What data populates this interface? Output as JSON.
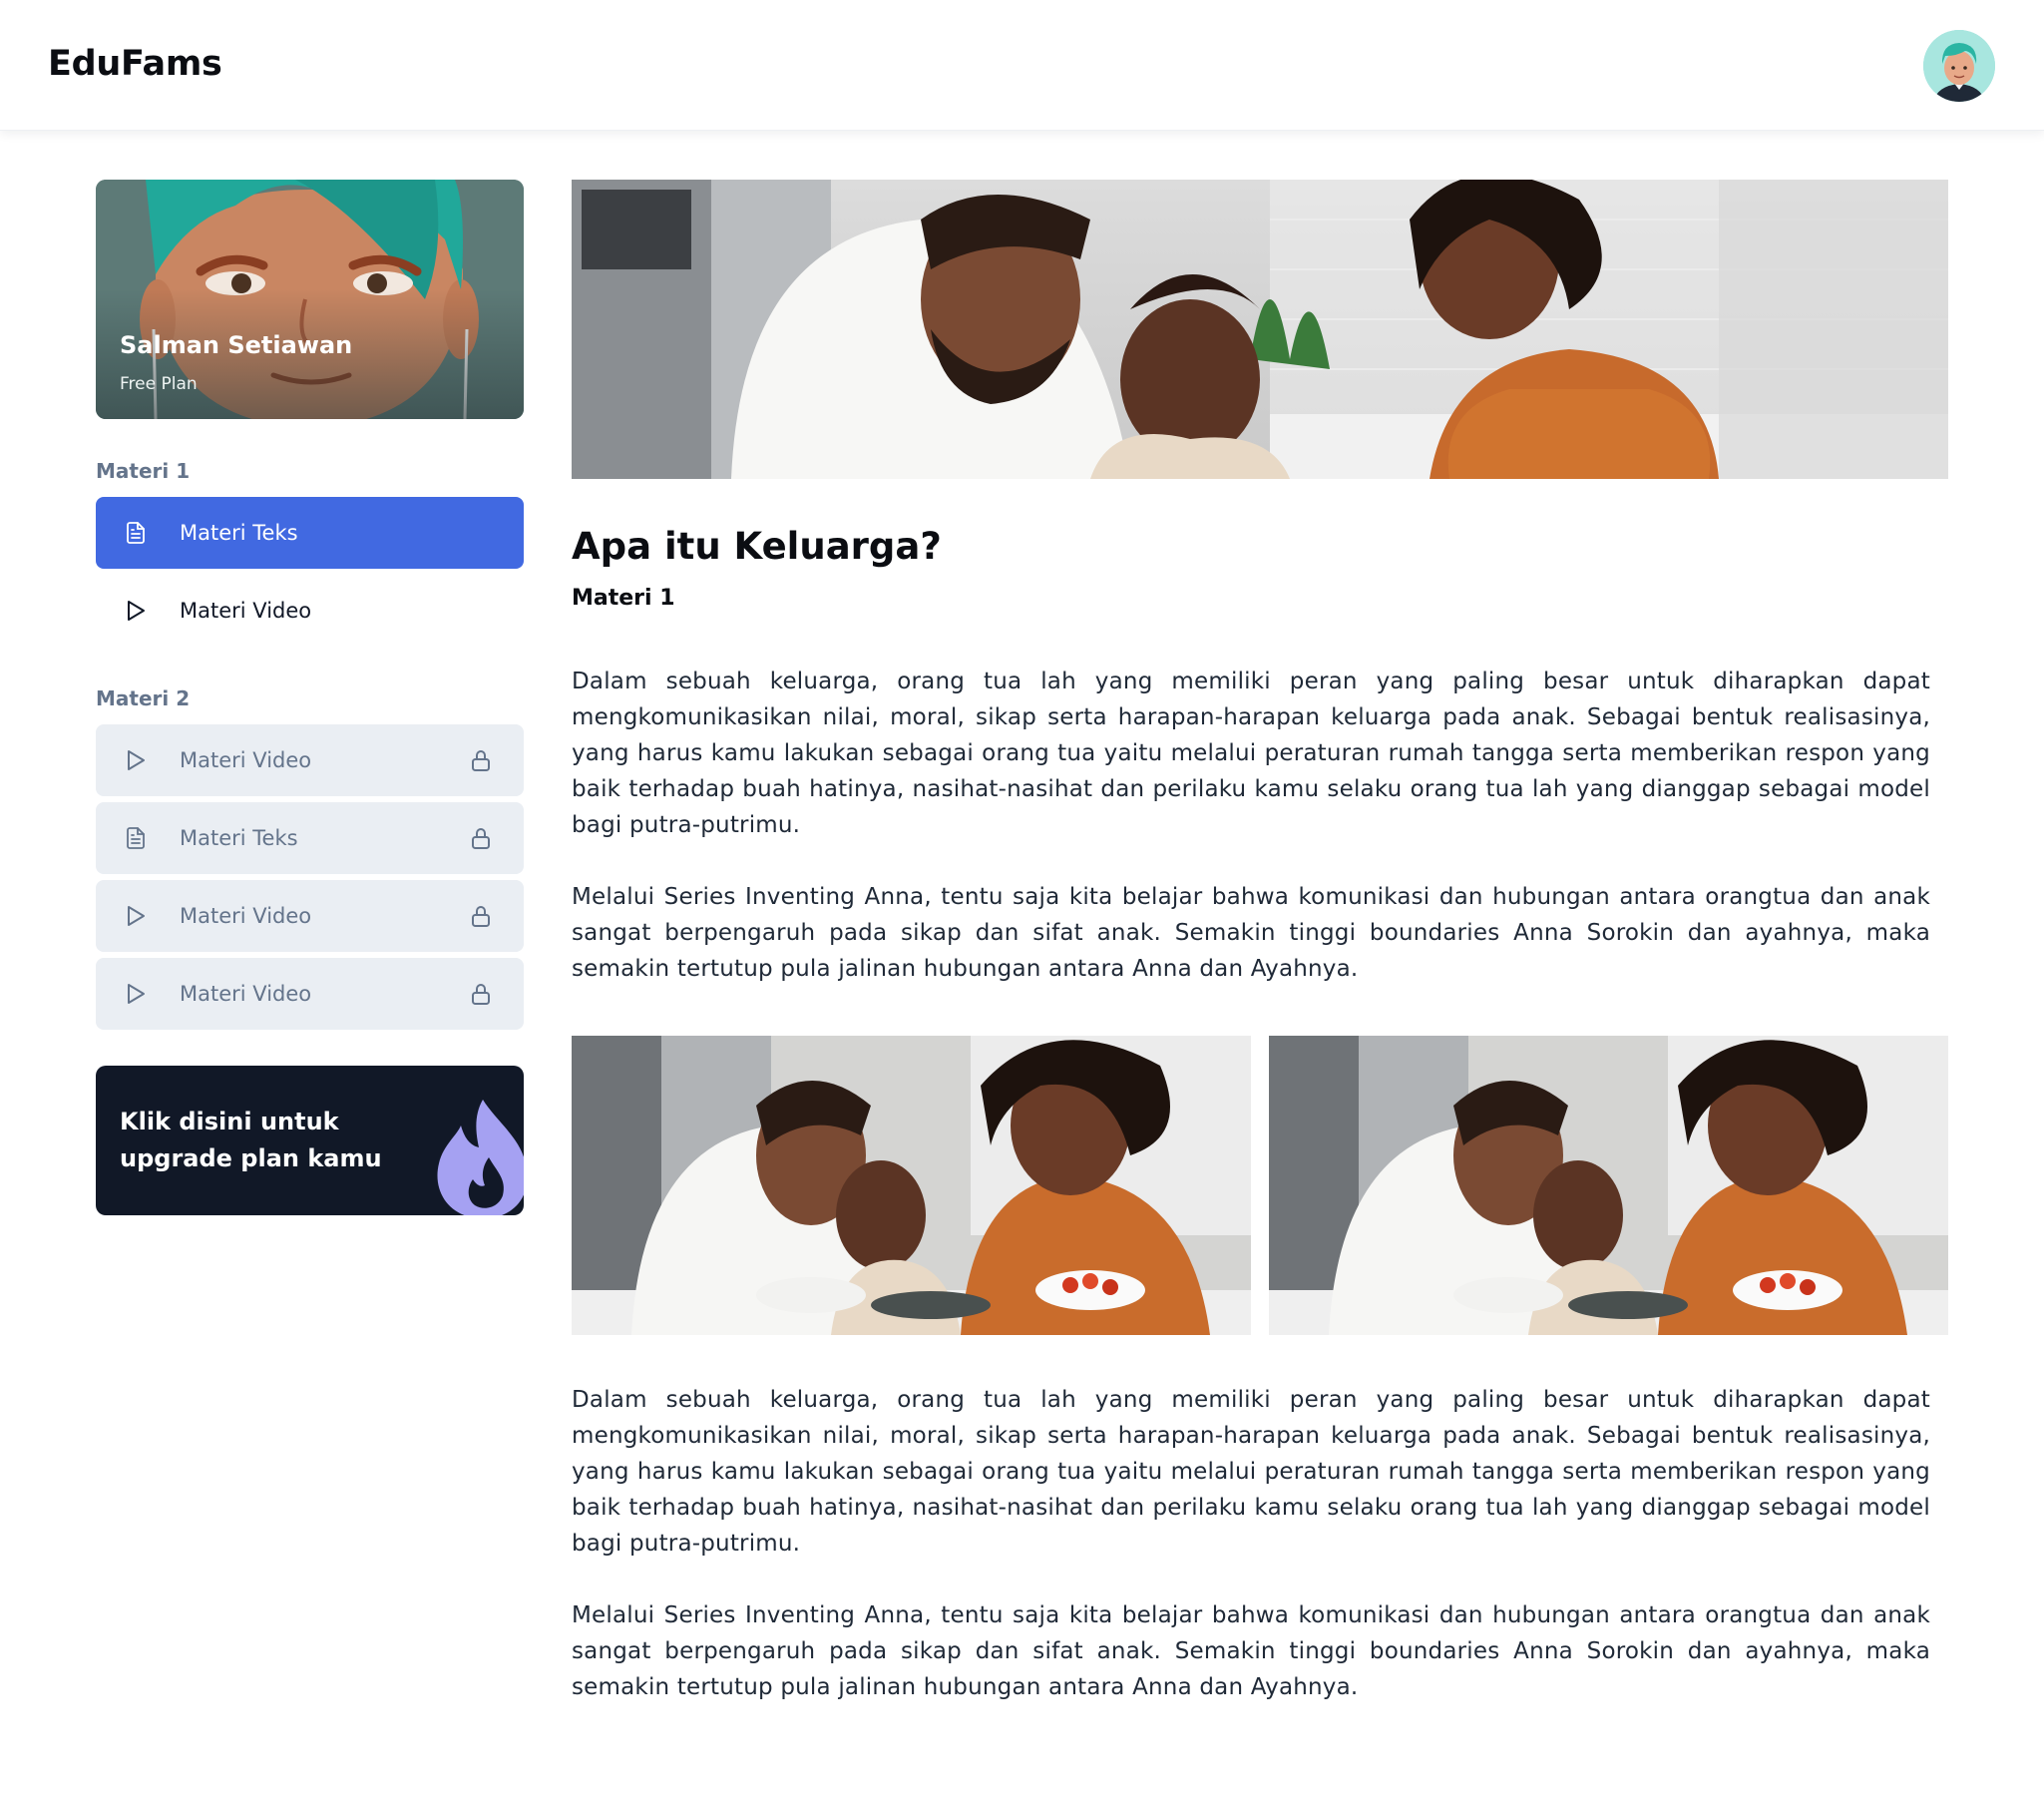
{
  "app": {
    "brand": "EduFams"
  },
  "profile": {
    "name": "Salman Setiawan",
    "plan": "Free Plan"
  },
  "sidebar": {
    "sections": [
      {
        "label": "Materi 1",
        "items": [
          {
            "label": "Materi Teks",
            "icon": "document-icon",
            "state": "active"
          },
          {
            "label": "Materi Video",
            "icon": "play-icon",
            "state": "unlocked"
          }
        ]
      },
      {
        "label": "Materi 2",
        "items": [
          {
            "label": "Materi Video",
            "icon": "play-icon",
            "state": "locked"
          },
          {
            "label": "Materi Teks",
            "icon": "document-icon",
            "state": "locked"
          },
          {
            "label": "Materi Video",
            "icon": "play-icon",
            "state": "locked"
          },
          {
            "label": "Materi Video",
            "icon": "play-icon",
            "state": "locked"
          }
        ]
      }
    ],
    "upgrade": {
      "label": "Klik disini untuk upgrade plan kamu",
      "icon": "flame-icon"
    }
  },
  "article": {
    "title": "Apa itu Keluarga?",
    "subtitle": "Materi 1",
    "paragraphs": [
      "Dalam sebuah keluarga, orang tua lah yang memiliki peran yang paling besar untuk diharapkan dapat mengkomunikasikan nilai, moral, sikap serta harapan-harapan keluarga pada anak. Sebagai bentuk realisasinya, yang harus kamu lakukan sebagai orang tua yaitu melalui peraturan rumah tangga serta memberikan respon yang baik terhadap buah hatinya, nasihat-nasihat dan perilaku kamu selaku orang tua lah yang dianggap sebagai model bagi putra-putrimu.",
      "Melalui Series Inventing Anna, tentu saja kita belajar bahwa komunikasi dan hubungan antara orangtua dan anak sangat berpengaruh pada sikap dan sifat anak. Semakin tinggi boundaries Anna Sorokin dan ayahnya, maka semakin tertutup pula jalinan hubungan antara Anna dan Ayahnya.",
      "Dalam sebuah keluarga, orang tua lah yang memiliki peran yang paling besar untuk diharapkan dapat mengkomunikasikan nilai, moral, sikap serta harapan-harapan keluarga pada anak. Sebagai bentuk realisasinya, yang harus kamu lakukan sebagai orang tua yaitu melalui peraturan rumah tangga serta memberikan respon yang baik terhadap buah hatinya, nasihat-nasihat dan perilaku kamu selaku orang tua lah yang dianggap sebagai model bagi putra-putrimu.",
      "Melalui Series Inventing Anna, tentu saja kita belajar bahwa komunikasi dan hubungan antara orangtua dan anak sangat berpengaruh pada sikap dan sifat anak. Semakin tinggi boundaries Anna Sorokin dan ayahnya, maka semakin tertutup pula jalinan hubungan antara Anna dan Ayahnya."
    ]
  },
  "colors": {
    "accent": "#4169e1",
    "locked_bg": "#eaeef3",
    "muted_text": "#64748b",
    "upgrade_bg": "#111827",
    "flame": "#a5a1f2"
  }
}
